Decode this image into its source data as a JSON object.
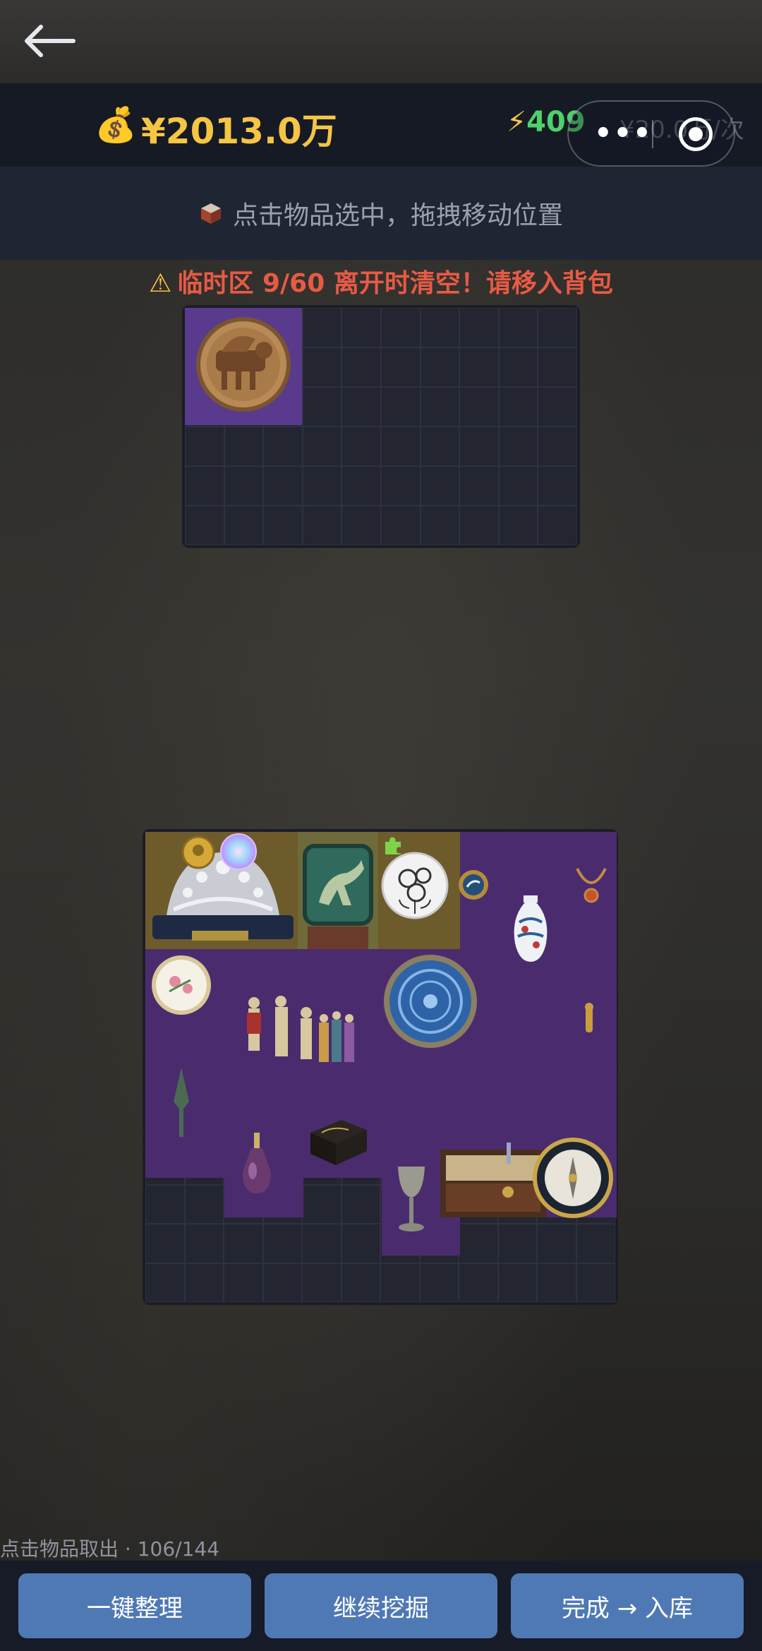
{
  "header": {
    "money_icon": "money-bag-icon",
    "money": "¥2013.0万",
    "energy_bolt": "⚡",
    "energy": "409",
    "price": "¥20.0万/次",
    "menu_dots": "•••"
  },
  "hint": {
    "icon": "box-icon",
    "text": "点击物品选中，拖拽移动位置"
  },
  "warning": {
    "icon": "⚠",
    "text": "临时区 9/60  离开时清空！请移入背包"
  },
  "temp_zone": {
    "used": 9,
    "capacity": 60,
    "columns": 10,
    "rows": 6
  },
  "bag": {
    "used": 106,
    "capacity": 144,
    "columns": 12,
    "rows": 12
  },
  "footer": {
    "status": "点击物品取出 · 106/144"
  },
  "buttons": {
    "organize": "一键整理",
    "continue": "继续挖掘",
    "finish": "完成 → 入库"
  },
  "colors": {
    "gold": "#f6c544",
    "purple_rarity": "#4a2c6e",
    "olive_rarity": "#6e5b2c",
    "button": "#4f79b4",
    "warning": "#e85a45"
  }
}
